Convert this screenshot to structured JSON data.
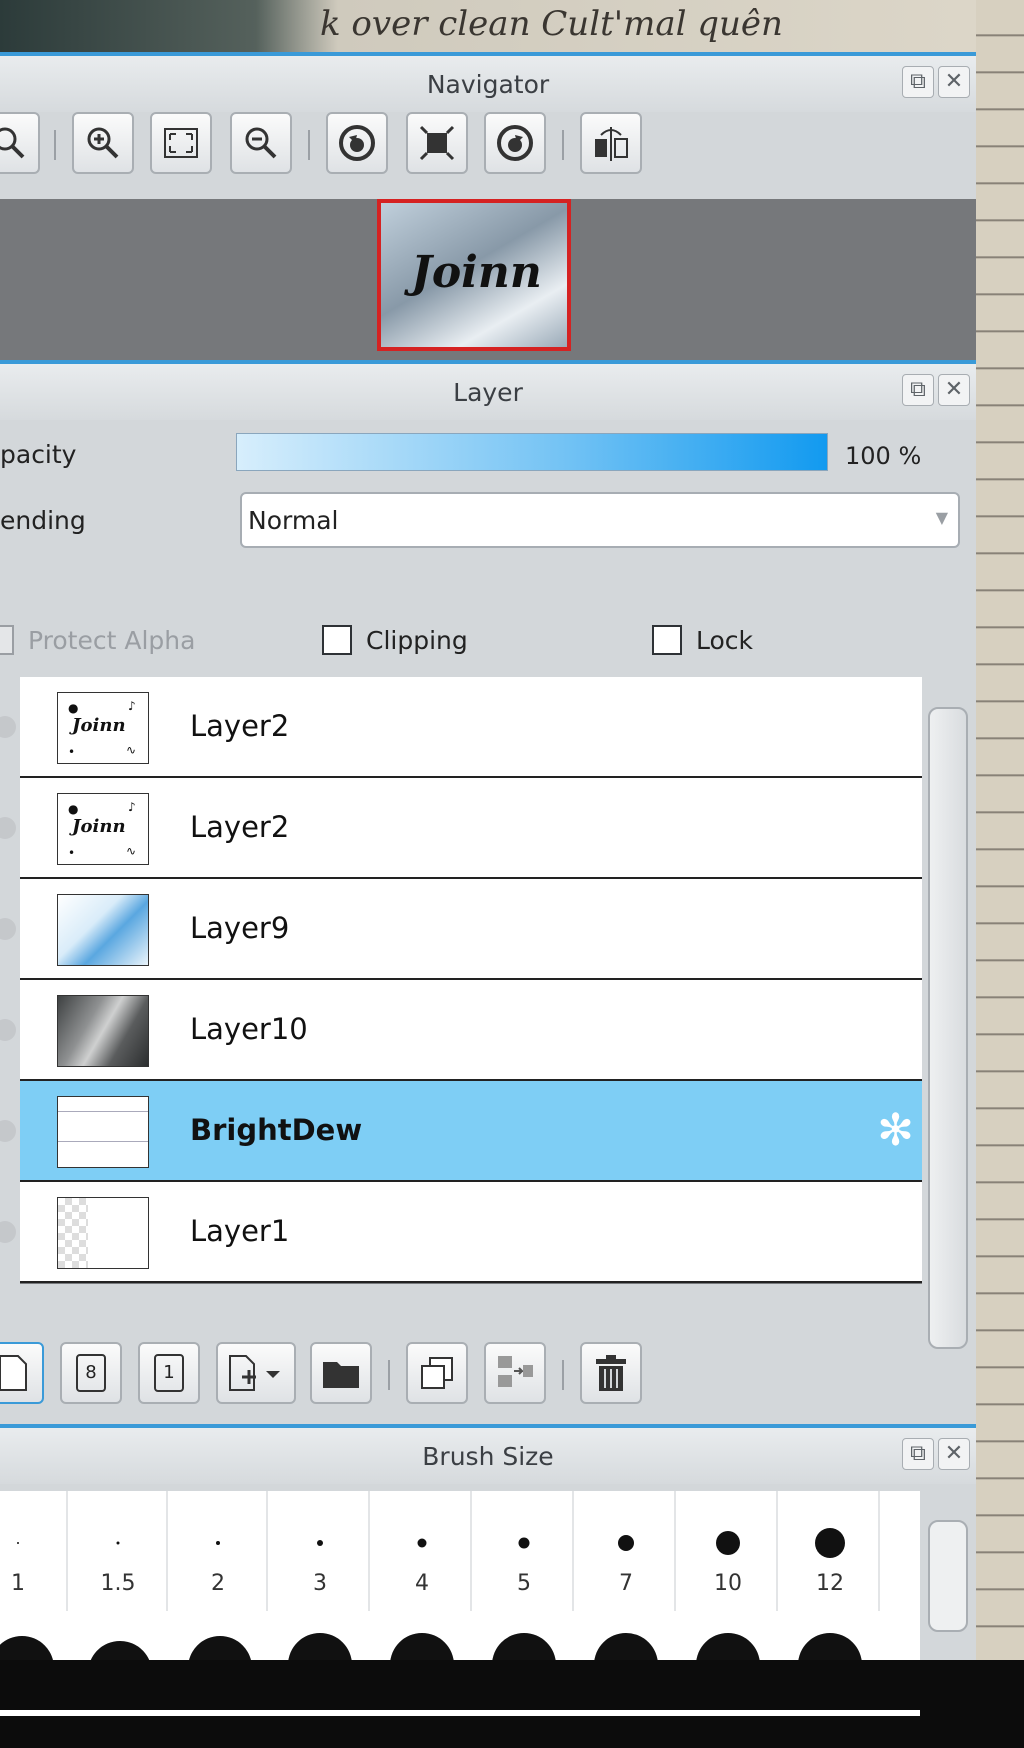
{
  "background": {
    "handwriting_top": "k over clean Cult'mal quên"
  },
  "navigator": {
    "title": "Navigator",
    "thumbnail_text": "Joinn",
    "tools": [
      "zoom-icon",
      "zoom-in-icon",
      "fit-icon",
      "zoom-out-icon",
      "rotate-left-icon",
      "actual-size-icon",
      "rotate-right-icon",
      "flip-icon"
    ]
  },
  "layer_panel": {
    "title": "Layer",
    "opacity_label": "pacity",
    "opacity_value": "100 %",
    "opacity_fraction": 1.0,
    "blending_label": "ending",
    "blending_value": "Normal",
    "protect_alpha_label": "Protect Alpha",
    "clipping_label": "Clipping",
    "lock_label": "Lock",
    "accent_color": "#7ecef5",
    "layers": [
      {
        "name": "Layer2",
        "thumb": "ink"
      },
      {
        "name": "Layer2",
        "thumb": "ink"
      },
      {
        "name": "Layer9",
        "thumb": "sky"
      },
      {
        "name": "Layer10",
        "thumb": "window"
      },
      {
        "name": "BrightDew",
        "thumb": "texture",
        "selected": true
      },
      {
        "name": "Layer1",
        "thumb": "transparent"
      }
    ],
    "thumb_word": "Joinn",
    "bottom_tools": [
      "new-layer-icon",
      "new-8bit-layer-icon",
      "new-1bit-layer-icon",
      "add-layer-dropdown-icon",
      "folder-icon",
      "duplicate-icon",
      "merge-icon",
      "delete-icon"
    ],
    "eight_label": "8",
    "one_label": "1"
  },
  "brush_size": {
    "title": "Brush Size",
    "sizes": [
      "1",
      "1.5",
      "2",
      "3",
      "4",
      "5",
      "7",
      "10",
      "12"
    ]
  },
  "window_buttons": {
    "float_glyph": "⧉",
    "close_glyph": "✕"
  },
  "gear_glyph": "✻"
}
